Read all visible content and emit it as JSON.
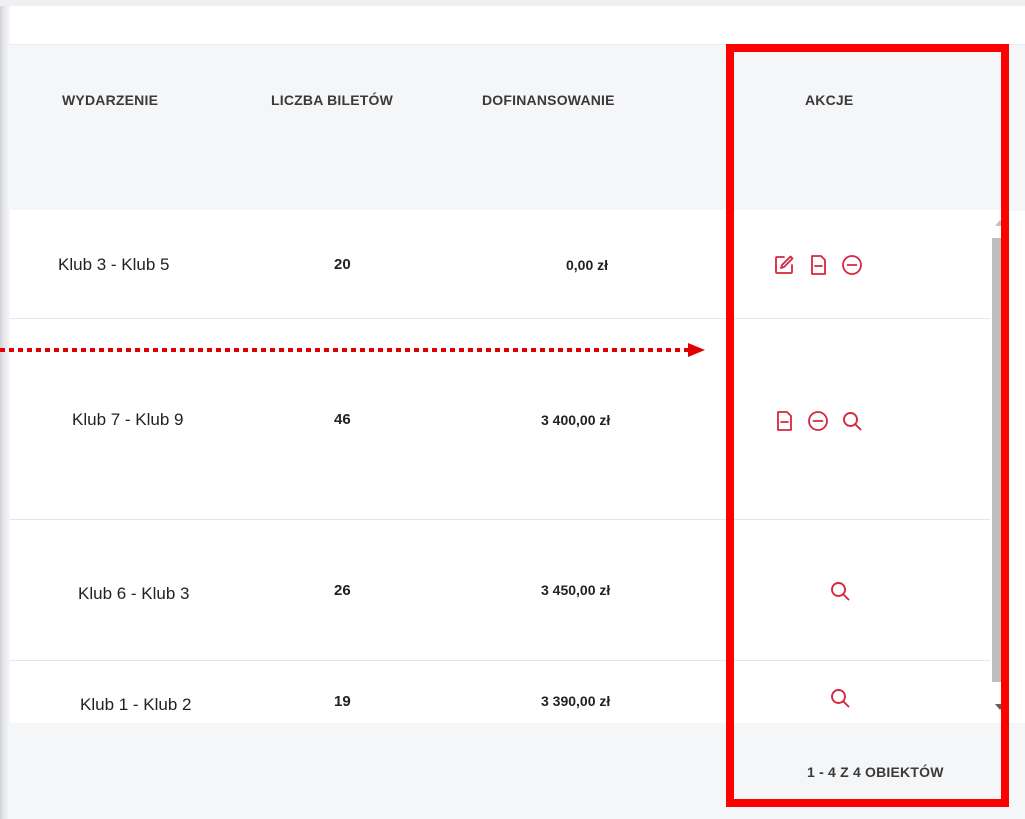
{
  "table": {
    "columns": {
      "event": "WYDARZENIE",
      "tickets": "LICZBA BILETÓW",
      "funding": "DOFINANSOWANIE",
      "actions": "AKCJE"
    },
    "rows": [
      {
        "event": "Klub 3 - Klub 5",
        "tickets": "20",
        "funding": "0,00 zł",
        "actions": [
          "edit-icon",
          "document-icon",
          "remove-icon"
        ]
      },
      {
        "event": "Klub 7 - Klub 9",
        "tickets": "46",
        "funding": "3 400,00 zł",
        "actions": [
          "document-icon",
          "remove-icon",
          "search-icon"
        ]
      },
      {
        "event": "Klub 6 - Klub 3",
        "tickets": "26",
        "funding": "3 450,00 zł",
        "actions": [
          "search-icon"
        ]
      },
      {
        "event": "Klub 1 - Klub 2",
        "tickets": "19",
        "funding": "3 390,00 zł",
        "actions": [
          "search-icon"
        ]
      }
    ],
    "pager": "1 - 4 Z 4 OBIEKTÓW"
  },
  "colors": {
    "accent_icon": "#d7263d",
    "highlight_box": "#ff0000",
    "arrow": "#e00000",
    "header_bg": "#f5f6f8"
  }
}
